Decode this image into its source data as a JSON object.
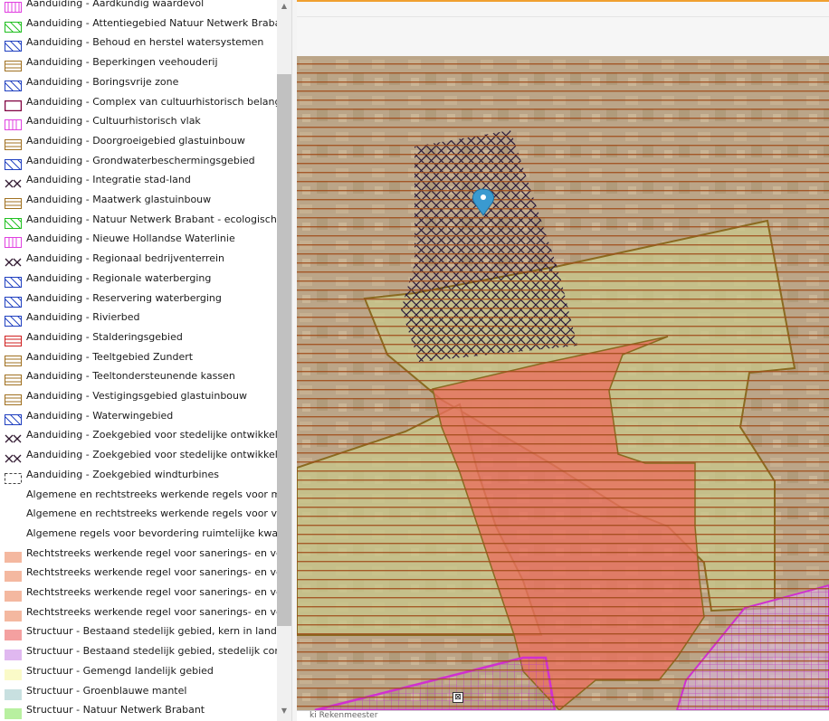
{
  "legend": {
    "items": [
      {
        "label": "Aanduiding - Aardkundig waardevol",
        "style": "hatch",
        "color": "#e040e0"
      },
      {
        "label": "Aanduiding - Attentiegebied Natuur Netwerk Brabant",
        "style": "diag",
        "color": "#20c020"
      },
      {
        "label": "Aanduiding - Behoud en herstel watersystemen",
        "style": "diag",
        "color": "#2040c0"
      },
      {
        "label": "Aanduiding - Beperkingen veehouderij",
        "style": "hlines",
        "color": "#a07020"
      },
      {
        "label": "Aanduiding - Boringsvrije zone",
        "style": "diag",
        "color": "#2040c0"
      },
      {
        "label": "Aanduiding - Complex van cultuurhistorisch belang",
        "style": "box",
        "color": "#800040"
      },
      {
        "label": "Aanduiding - Cultuurhistorisch vlak",
        "style": "vlines",
        "color": "#e040e0"
      },
      {
        "label": "Aanduiding - Doorgroeigebied glastuinbouw",
        "style": "hlines",
        "color": "#a07020"
      },
      {
        "label": "Aanduiding - Grondwaterbeschermingsgebied",
        "style": "diag",
        "color": "#2040c0"
      },
      {
        "label": "Aanduiding - Integratie stad-land",
        "style": "cross",
        "color": "#301830"
      },
      {
        "label": "Aanduiding - Maatwerk glastuinbouw",
        "style": "hlines",
        "color": "#a07020"
      },
      {
        "label": "Aanduiding - Natuur Netwerk Brabant - ecologische verbi",
        "style": "diag",
        "color": "#20c020"
      },
      {
        "label": "Aanduiding - Nieuwe Hollandse Waterlinie",
        "style": "vlines",
        "color": "#e040e0"
      },
      {
        "label": "Aanduiding - Regionaal bedrijventerrein",
        "style": "cross",
        "color": "#301830"
      },
      {
        "label": "Aanduiding - Regionale waterberging",
        "style": "diag",
        "color": "#2040c0"
      },
      {
        "label": "Aanduiding - Reservering waterberging",
        "style": "diag",
        "color": "#2040c0"
      },
      {
        "label": "Aanduiding - Rivierbed",
        "style": "diag",
        "color": "#2040c0"
      },
      {
        "label": "Aanduiding - Stalderingsgebied",
        "style": "hlines",
        "color": "#d02020"
      },
      {
        "label": "Aanduiding - Teeltgebied Zundert",
        "style": "hlines",
        "color": "#a07020"
      },
      {
        "label": "Aanduiding - Teeltondersteunende kassen",
        "style": "hlines",
        "color": "#a07020"
      },
      {
        "label": "Aanduiding - Vestigingsgebied glastuinbouw",
        "style": "hlines",
        "color": "#a07020"
      },
      {
        "label": "Aanduiding - Waterwingebied",
        "style": "diag",
        "color": "#2040c0"
      },
      {
        "label": "Aanduiding - Zoekgebied voor stedelijke ontwikkeling, k",
        "style": "cross",
        "color": "#301830"
      },
      {
        "label": "Aanduiding - Zoekgebied voor stedelijke ontwikkeling, s",
        "style": "cross",
        "color": "#301830"
      },
      {
        "label": "Aanduiding - Zoekgebied windturbines",
        "style": "dashed",
        "color": "#404040"
      },
      {
        "label": "Algemene en rechtstreeks werkende regels voor mestbe",
        "style": "none",
        "color": "#ffffff"
      },
      {
        "label": "Algemene en rechtstreeks werkende regels voor veehou",
        "style": "none",
        "color": "#ffffff"
      },
      {
        "label": "Algemene regels voor bevordering ruimtelijke kwaliteit",
        "style": "none",
        "color": "#ffffff"
      },
      {
        "label": "Rechtstreeks werkende regel voor sanerings- en verplaa",
        "style": "fill",
        "color": "#f4b8a0"
      },
      {
        "label": "Rechtstreeks werkende regel voor sanerings- en verplaa",
        "style": "fill",
        "color": "#f4b8a0"
      },
      {
        "label": "Rechtstreeks werkende regel voor sanerings- en verplaa",
        "style": "fill",
        "color": "#f4b8a0"
      },
      {
        "label": "Rechtstreeks werkende regel voor sanerings- en verplaa",
        "style": "fill",
        "color": "#f4b8a0"
      },
      {
        "label": "Structuur - Bestaand stedelijk gebied, kern in landelijk g",
        "style": "fill",
        "color": "#f4a0a0"
      },
      {
        "label": "Structuur - Bestaand stedelijk gebied, stedelijk concent",
        "style": "fill",
        "color": "#e0b8f0"
      },
      {
        "label": "Structuur - Gemengd landelijk gebied",
        "style": "fill",
        "color": "#fafac8"
      },
      {
        "label": "Structuur - Groenblauwe mantel",
        "style": "fill",
        "color": "#c8e0e0"
      },
      {
        "label": "Structuur - Natuur Netwerk Brabant",
        "style": "fill",
        "color": "#b8f0a0"
      }
    ]
  },
  "map": {
    "footer_text": "ki Rekenmeester",
    "marker_icon": "map-pin-icon",
    "colors": {
      "agri": "#c9c98a",
      "urban": "#e8705e",
      "line_brown": "#8a6a20",
      "stripe": "#a05018",
      "cross": "#2a1a3a",
      "magenta": "#d030d0",
      "marker": "#3a9ad0"
    }
  }
}
